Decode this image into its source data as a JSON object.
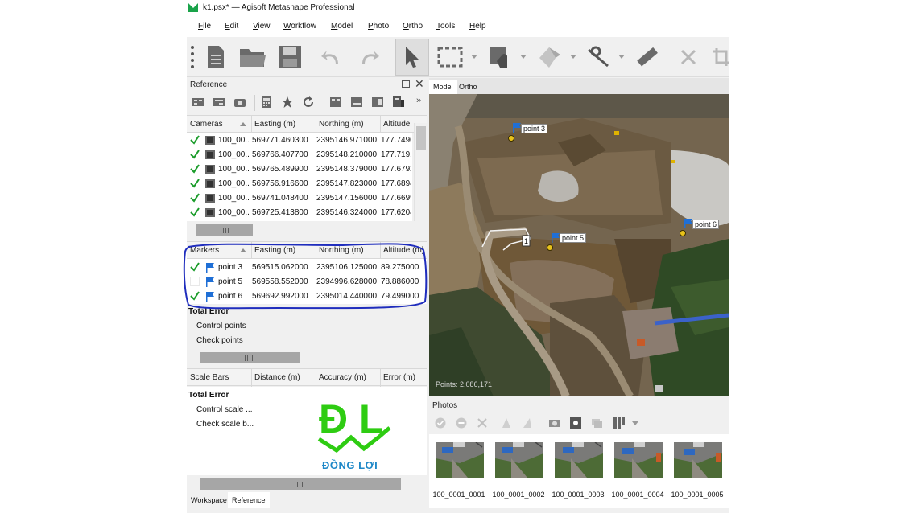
{
  "window": {
    "title": "k1.psx* — Agisoft Metashape Professional"
  },
  "menu": [
    {
      "label": "File",
      "mnemonic": "F",
      "rest": "ile"
    },
    {
      "label": "Edit",
      "mnemonic": "E",
      "rest": "dit"
    },
    {
      "label": "View",
      "mnemonic": "V",
      "rest": "iew"
    },
    {
      "label": "Workflow",
      "mnemonic": "W",
      "rest": "orkflow"
    },
    {
      "label": "Model",
      "mnemonic": "M",
      "rest": "odel"
    },
    {
      "label": "Photo",
      "mnemonic": "P",
      "rest": "hoto"
    },
    {
      "label": "Ortho",
      "mnemonic": "O",
      "rest": "rtho"
    },
    {
      "label": "Tools",
      "mnemonic": "T",
      "rest": "ools"
    },
    {
      "label": "Help",
      "mnemonic": "H",
      "rest": "elp"
    }
  ],
  "toolbar": {
    "icons": [
      "new-document-icon",
      "open-folder-icon",
      "save-icon",
      "undo-icon",
      "redo-icon",
      "navigation-arrow-icon",
      "rectangle-selection-icon",
      "selection-tool-icon",
      "move-object-icon",
      "ruler-icon",
      "measure-icon",
      "delete-icon",
      "crop-icon"
    ]
  },
  "reference": {
    "title": "Reference",
    "cameras": {
      "headers": [
        "Cameras",
        "Easting (m)",
        "Northing (m)",
        "Altitude"
      ],
      "rows": [
        {
          "checked": true,
          "label": "100_00...",
          "easting": "569771.460300",
          "northing": "2395146.971000",
          "altitude": "177.7490"
        },
        {
          "checked": true,
          "label": "100_00...",
          "easting": "569766.407700",
          "northing": "2395148.210000",
          "altitude": "177.7191"
        },
        {
          "checked": true,
          "label": "100_00...",
          "easting": "569765.489900",
          "northing": "2395148.379000",
          "altitude": "177.6792"
        },
        {
          "checked": true,
          "label": "100_00...",
          "easting": "569756.916600",
          "northing": "2395147.823000",
          "altitude": "177.6894"
        },
        {
          "checked": true,
          "label": "100_00...",
          "easting": "569741.048400",
          "northing": "2395147.156000",
          "altitude": "177.6699"
        },
        {
          "checked": true,
          "label": "100_00...",
          "easting": "569725.413800",
          "northing": "2395146.324000",
          "altitude": "177.6204"
        }
      ]
    },
    "markers": {
      "headers": [
        "Markers",
        "Easting (m)",
        "Northing (m)",
        "Altitude (m)"
      ],
      "rows": [
        {
          "checked": true,
          "label": "point 3",
          "easting": "569515.062000",
          "northing": "2395106.125000",
          "altitude": "89.275000"
        },
        {
          "checked": false,
          "label": "point 5",
          "easting": "569558.552000",
          "northing": "2394996.628000",
          "altitude": "78.886000"
        },
        {
          "checked": true,
          "label": "point 6",
          "easting": "569692.992000",
          "northing": "2395014.440000",
          "altitude": "79.499000"
        }
      ],
      "total_error": "Total Error",
      "control_points": "Control points",
      "check_points": "Check points"
    },
    "scalebars": {
      "headers": [
        "Scale Bars",
        "Distance (m)",
        "Accuracy (m)",
        "Error (m)"
      ],
      "total_error": "Total Error",
      "control_scale": "Control scale ...",
      "check_scale": "Check scale b..."
    }
  },
  "bottom_tabs": [
    "Workspace",
    "Reference"
  ],
  "model_tabs": [
    "Model",
    "Ortho"
  ],
  "model_view": {
    "markers": [
      {
        "label": "point 3"
      },
      {
        "label": "point 5"
      },
      {
        "label": "point 6"
      }
    ],
    "scale_label": "1",
    "points_readout": "Points: 2,086,171"
  },
  "photos": {
    "title": "Photos",
    "items": [
      "100_0001_0001",
      "100_0001_0002",
      "100_0001_0003",
      "100_0001_0004",
      "100_0001_0005"
    ]
  },
  "watermark": {
    "letters": "Đ L",
    "text": "ĐỒNG LỢI"
  },
  "colors": {
    "annotation": "#1f2dbd",
    "logo_green": "#2ecc12",
    "logo_blue": "#1e88c8",
    "marker_flag": "#1f6fd6"
  }
}
